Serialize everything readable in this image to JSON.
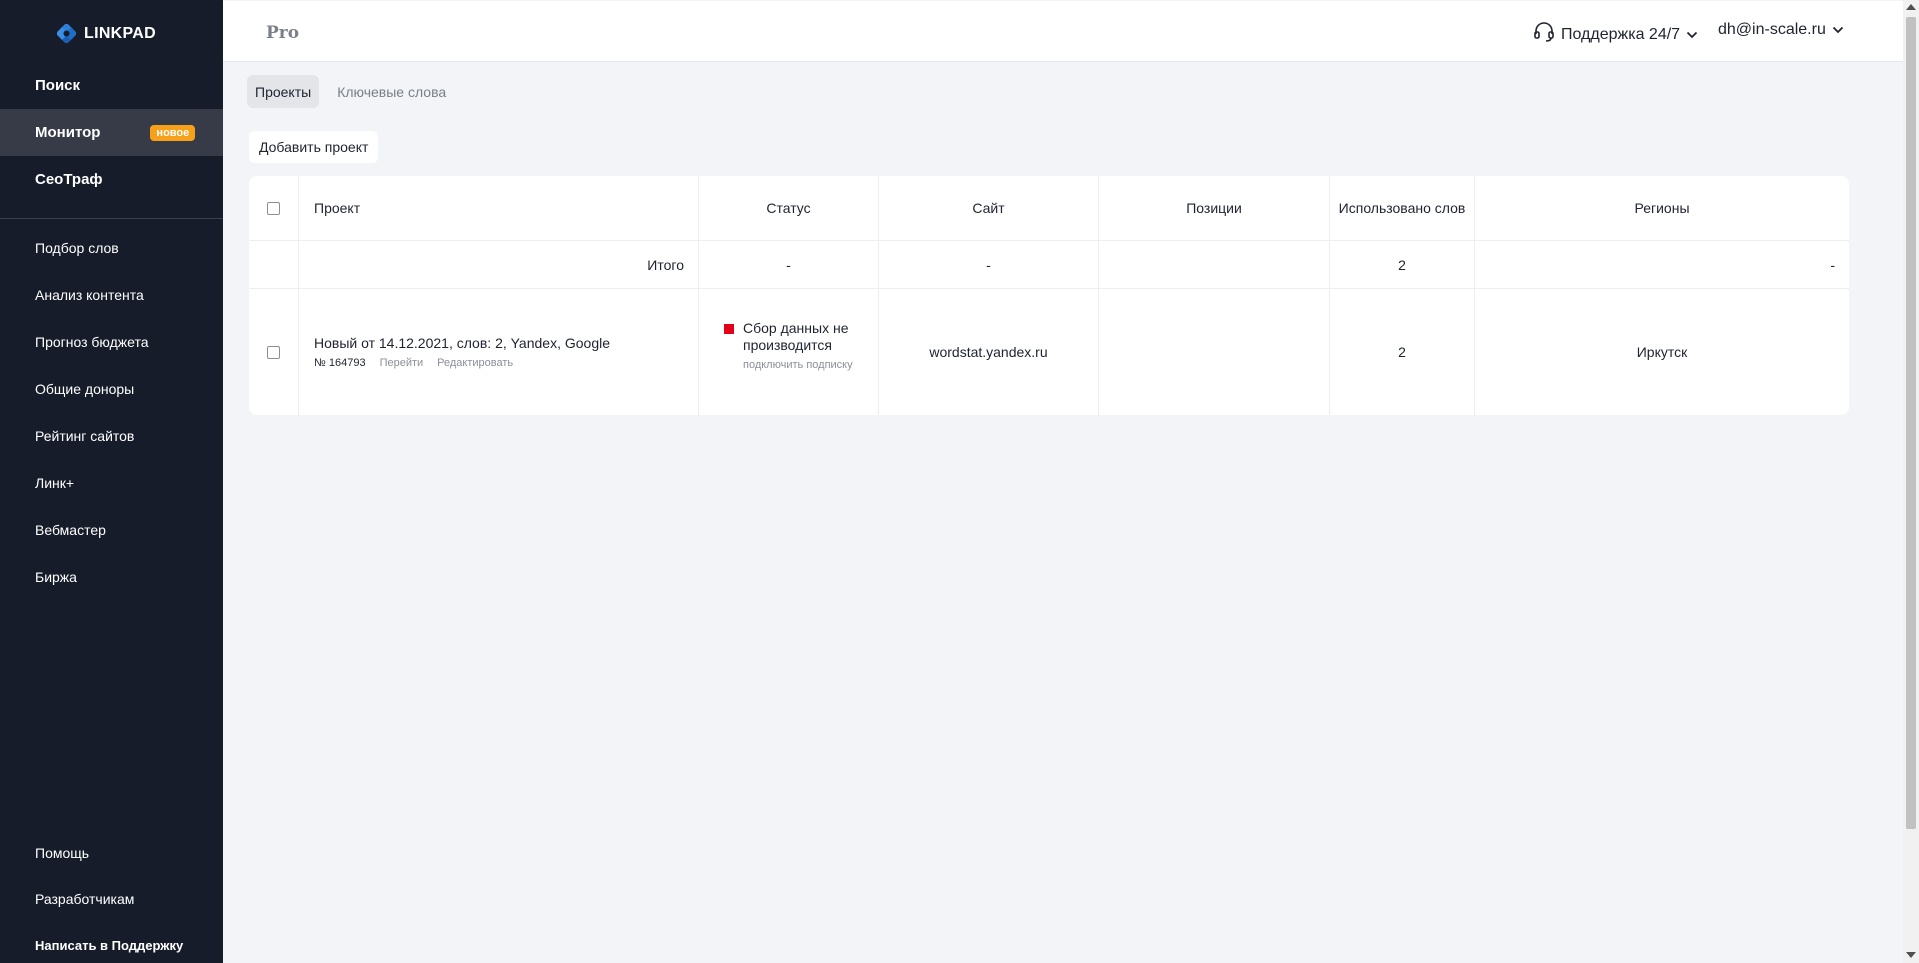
{
  "brand": {
    "name": "LINKPAD",
    "logo_icon": "linkpad-logo-icon",
    "accent": "#1e6ec8"
  },
  "sidebar": {
    "main": [
      {
        "label": "Поиск"
      },
      {
        "label": "Монитор",
        "badge": "новое",
        "active": true
      },
      {
        "label": "СеоТраф"
      }
    ],
    "tools": [
      {
        "label": "Подбор слов"
      },
      {
        "label": "Анализ контента"
      },
      {
        "label": "Прогноз бюджета"
      },
      {
        "label": "Общие доноры"
      },
      {
        "label": "Рейтинг сайтов"
      },
      {
        "label": "Линк+"
      },
      {
        "label": "Вебмастер"
      },
      {
        "label": "Биржа"
      }
    ],
    "bottom": [
      {
        "label": "Помощь"
      },
      {
        "label": "Разработчикам"
      },
      {
        "label": "Написать в Поддержку"
      }
    ]
  },
  "header": {
    "title": "Pro",
    "support_label": "Поддержка 24/7",
    "support_icon": "headset-icon",
    "user_email": "dh@in-scale.ru"
  },
  "tabs": [
    {
      "label": "Проекты",
      "active": true
    },
    {
      "label": "Ключевые слова",
      "active": false
    }
  ],
  "toolbar": {
    "add_project_label": "Добавить проект"
  },
  "table": {
    "columns": [
      "Проект",
      "Статус",
      "Сайт",
      "Позиции",
      "Использовано слов",
      "Регионы"
    ],
    "total_row": {
      "label": "Итого",
      "status": "-",
      "site": "-",
      "positions": "",
      "used_words": "2",
      "regions": "-"
    },
    "rows": [
      {
        "name": "Новый от 14.12.2021, слов: 2, Yandex, Google",
        "number": "№ 164793",
        "go_label": "Перейти",
        "edit_label": "Редактировать",
        "status": "Сбор данных не производится",
        "status_action": "подключить подписку",
        "status_color": "#e3001b",
        "site": "wordstat.yandex.ru",
        "positions": "",
        "used_words": "2",
        "regions": "Иркутск"
      }
    ]
  }
}
